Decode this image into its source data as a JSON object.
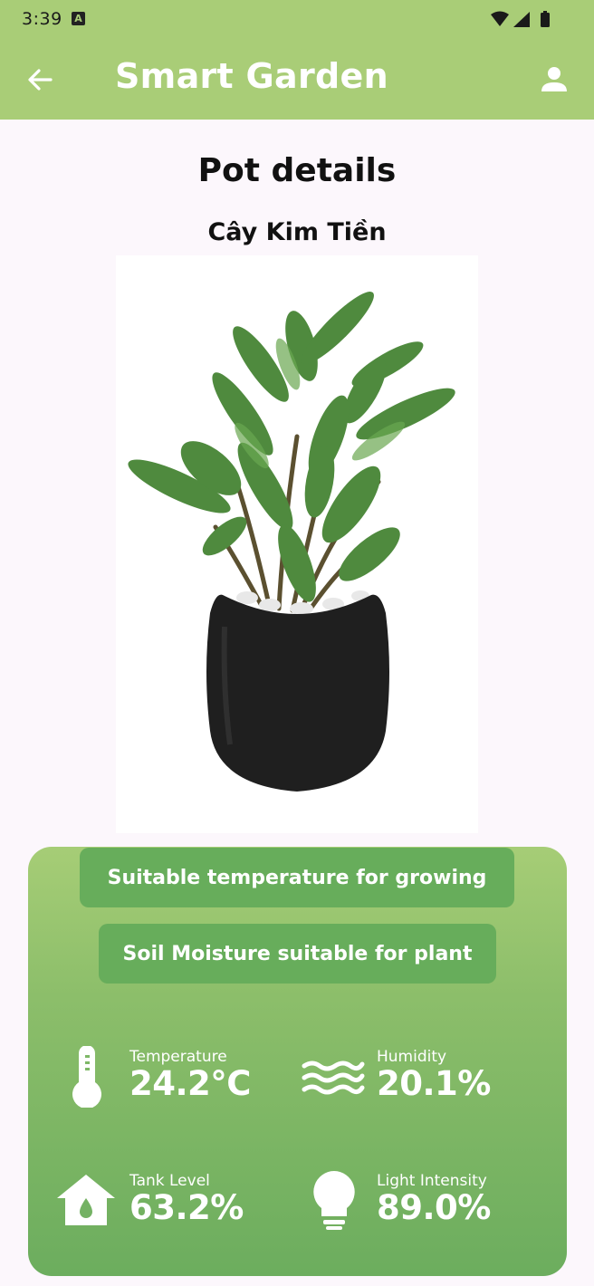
{
  "status_bar": {
    "time": "3:39",
    "notification_icon": "a-notification-icon",
    "icons": [
      "wifi-icon",
      "signal-icon",
      "battery-icon"
    ]
  },
  "app_bar": {
    "title": "Smart Garden",
    "back_icon": "arrow-left-icon",
    "profile_icon": "person-icon",
    "background": "#a9cd77"
  },
  "page": {
    "title": "Pot details",
    "plant_name": "Cây Kim Tiền",
    "plant_image": "potted-plant-image"
  },
  "status_messages": [
    "Suitable temperature for growing",
    "Soil Moisture suitable for plant"
  ],
  "metrics": [
    {
      "label": "Temperature",
      "value": "24.2°C",
      "icon": "thermometer-icon"
    },
    {
      "label": "Humidity",
      "value": "20.1%",
      "icon": "waves-icon"
    },
    {
      "label": "Tank Level",
      "value": "63.2%",
      "icon": "house-water-icon"
    },
    {
      "label": "Light Intensity",
      "value": "89.0%",
      "icon": "lightbulb-icon"
    }
  ],
  "colors": {
    "accent": "#a9cd77",
    "card_top": "#a6cd76",
    "card_bottom": "#6cad5e",
    "pill": "#67ad5b",
    "pot": "#1f1f1f",
    "leaf": "#4f8a3e"
  }
}
